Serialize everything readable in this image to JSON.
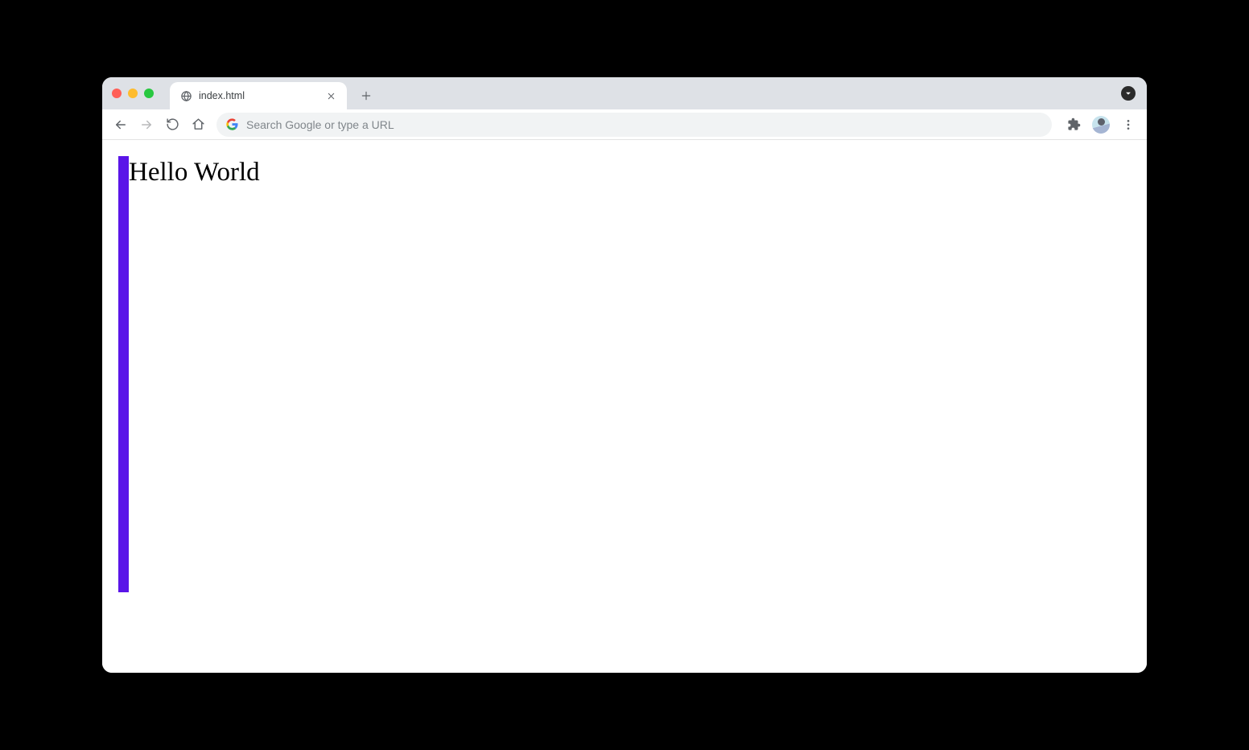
{
  "browser": {
    "tab_title": "index.html",
    "omnibox_placeholder": "Search Google or type a URL"
  },
  "page": {
    "heading": "Hello World",
    "bar_color": "#5a15e8"
  }
}
